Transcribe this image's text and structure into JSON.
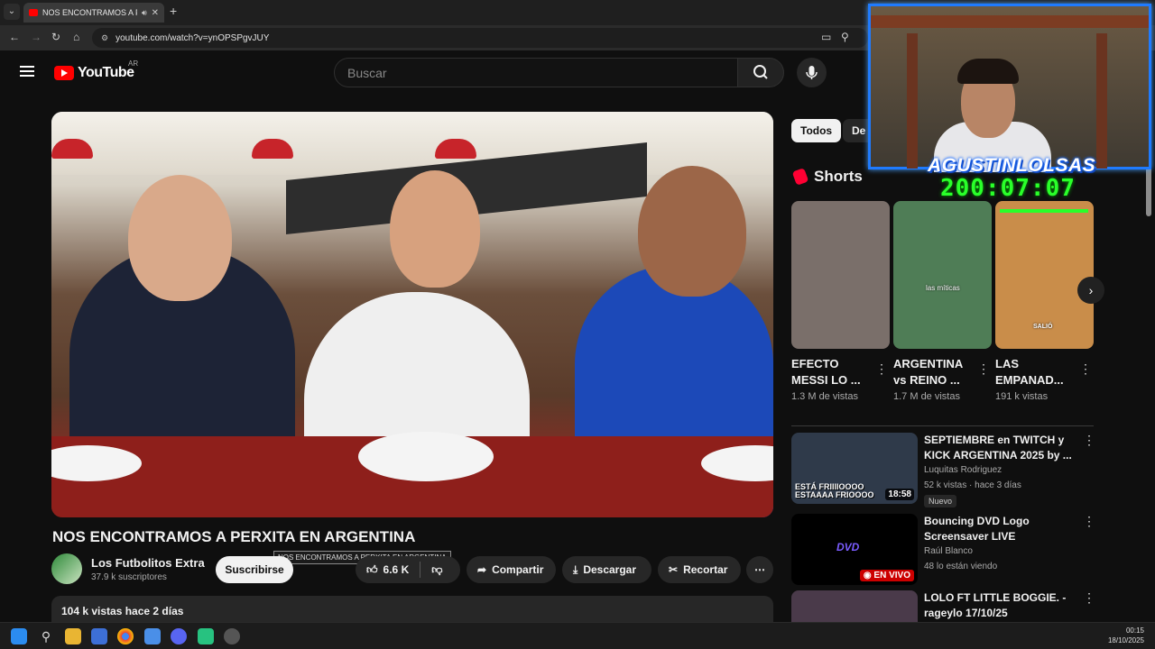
{
  "browser": {
    "tab_title": "NOS ENCONTRAMOS A PERXITA EN ARGENTINA",
    "url": "youtube.com/watch?v=ynOPSPgvJUY"
  },
  "header": {
    "logo_text": "YouTube",
    "country_code": "AR",
    "search_placeholder": "Buscar"
  },
  "video": {
    "title": "NOS ENCONTRAMOS A PERXITA EN ARGENTINA",
    "tooltip": "NOS ENCONTRAMOS A PERXITA EN ARGENTINA",
    "channel_name": "Los Futbolitos Extra",
    "subscribers": "37.9 k suscriptores",
    "subscribe_label": "Suscribirse",
    "likes": "6.6 K",
    "share_label": "Compartir",
    "download_label": "Descargar",
    "clip_label": "Recortar",
    "views_date": "104 k vistas  hace 2 días"
  },
  "filters": {
    "active": "Todos",
    "other": "De"
  },
  "shorts": {
    "heading": "Shorts",
    "items": [
      {
        "title": "EFECTO MESSI LO ...",
        "views": "1.3 M de vistas",
        "overlay": "",
        "color": "#7a6f6a"
      },
      {
        "title": "ARGENTINA vs REINO ...",
        "views": "1.7 M de vistas",
        "overlay": "las míticas",
        "color": "#4f7d56"
      },
      {
        "title": "LAS EMPANAD...",
        "views": "191 k vistas",
        "overlay": "SALIÓ",
        "color": "#c98d4a"
      }
    ]
  },
  "recommended": [
    {
      "title": "SEPTIEMBRE en TWITCH y KICK ARGENTINA 2025 by ...",
      "channel": "Luquitas Rodriguez",
      "meta": "52 k vistas · hace 3 días",
      "duration": "18:58",
      "badge": "Nuevo",
      "thumb_text": "ESTÁ FRIIIIOOOO ESTAAAA FRIOOOO",
      "color": "#2f3a4a"
    },
    {
      "title": "Bouncing DVD Logo Screensaver LIVE",
      "channel": "Raúl Blanco",
      "meta": "48 lo están viendo",
      "live_label": "EN VIVO",
      "thumb_text": "DVD",
      "color": "#000000"
    },
    {
      "title": "LOLO FT LITTLE BOGGIE. - rageylo 17/10/25",
      "color": "#4a3a4a"
    }
  ],
  "stream_overlay": {
    "name": "AGUSTINLOLSAS",
    "timer": "200:07:07"
  },
  "taskbar": {
    "time": "00:15",
    "date": "18/10/2025"
  }
}
